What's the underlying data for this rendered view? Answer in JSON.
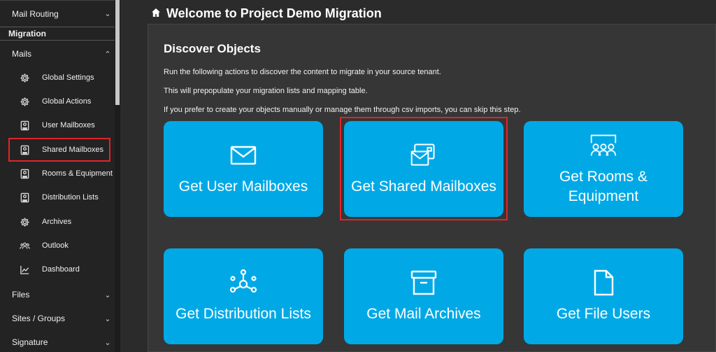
{
  "sidebar": {
    "top_item": "Mail Routing",
    "section": "Migration",
    "mails_group": "Mails",
    "items": [
      {
        "label": "Global Settings",
        "icon": "gear-icon"
      },
      {
        "label": "Global Actions",
        "icon": "gear-icon"
      },
      {
        "label": "User Mailboxes",
        "icon": "mailbox-icon"
      },
      {
        "label": "Shared Mailboxes",
        "icon": "mailbox-icon"
      },
      {
        "label": "Rooms & Equipment",
        "icon": "mailbox-icon"
      },
      {
        "label": "Distribution Lists",
        "icon": "mailbox-icon"
      },
      {
        "label": "Archives",
        "icon": "gear-icon"
      },
      {
        "label": "Outlook",
        "icon": "people-icon"
      },
      {
        "label": "Dashboard",
        "icon": "chart-icon"
      }
    ],
    "bottom_groups": [
      "Files",
      "Sites / Groups",
      "Signature"
    ]
  },
  "header": {
    "title": "Welcome to Project Demo Migration"
  },
  "panel": {
    "title": "Discover Objects",
    "lines": [
      "Run the following actions to discover the content to migrate in your source tenant.",
      "This will prepopulate your migration lists and mapping table.",
      "If you prefer to create your objects manually or manage them through csv imports, you can skip this step."
    ]
  },
  "tiles": [
    {
      "label": "Get User Mailboxes",
      "icon": "envelope-icon"
    },
    {
      "label": "Get Shared Mailboxes",
      "icon": "shared-mail-icon"
    },
    {
      "label": "Get Rooms & Equipment",
      "icon": "meeting-room-icon"
    },
    {
      "label": "Get Distribution Lists",
      "icon": "network-icon"
    },
    {
      "label": "Get Mail Archives",
      "icon": "archive-box-icon"
    },
    {
      "label": "Get File Users",
      "icon": "file-icon"
    }
  ],
  "colors": {
    "tile": "#00a9e6",
    "highlight": "#e0242b",
    "background": "#2b2b2b"
  }
}
